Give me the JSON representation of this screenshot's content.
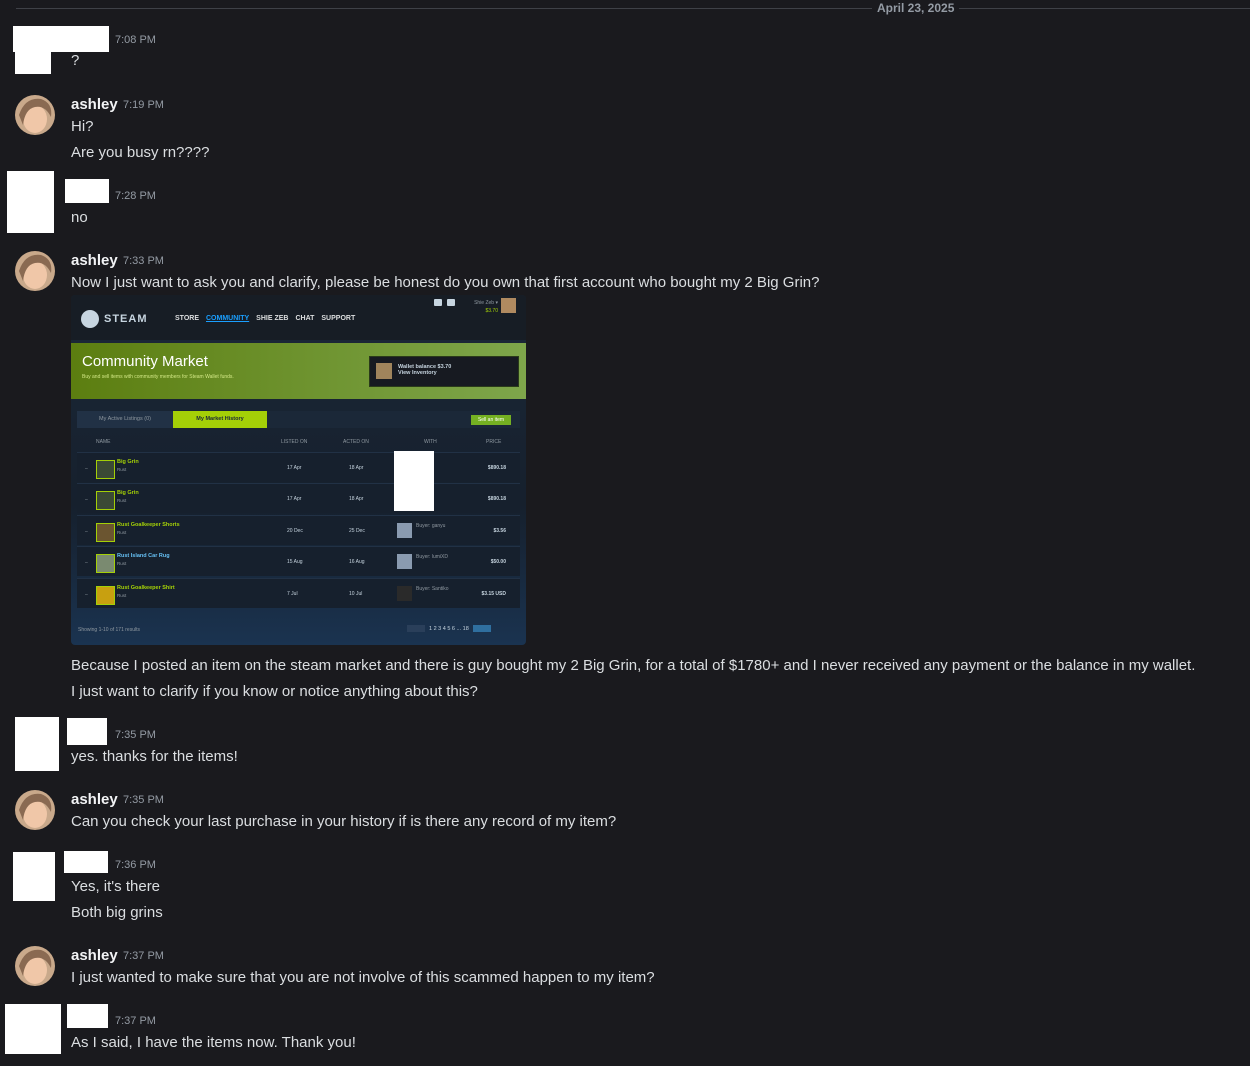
{
  "date_divider": "April 23, 2025",
  "messages": {
    "m1": {
      "time": "7:08 PM",
      "lines": [
        "?"
      ]
    },
    "m2": {
      "author": "ashley",
      "time": "7:19 PM",
      "lines": [
        "Hi?",
        "Are you busy rn????"
      ]
    },
    "m3": {
      "time": "7:28 PM",
      "lines": [
        "no"
      ]
    },
    "m4": {
      "author": "ashley",
      "time": "7:33 PM",
      "lines": [
        "Now I just want to ask you and clarify, please be honest do you own that first account who bought my 2 Big Grin?",
        "Because I posted an item on the steam market and there is guy bought my 2 Big Grin, for a total of $1780+ and I never received any payment or the balance in my wallet.",
        "I just want to clarify if you know or notice anything about this?"
      ]
    },
    "m5": {
      "time": "7:35 PM",
      "lines": [
        "yes. thanks for the items!"
      ]
    },
    "m6": {
      "author": "ashley",
      "time": "7:35 PM",
      "lines": [
        "Can you check your last purchase in your history if is there any record of my item?"
      ]
    },
    "m7": {
      "time": "7:36 PM",
      "lines": [
        "Yes, it's there",
        "Both big grins"
      ]
    },
    "m8": {
      "author": "ashley",
      "time": "7:37 PM",
      "lines": [
        "I just wanted to make sure that you are not involve of this scammed happen to my item?"
      ]
    },
    "m9": {
      "time": "7:37 PM",
      "lines": [
        "As I said, I have the items now. Thank you!"
      ]
    }
  },
  "steam": {
    "logo": "STEAM",
    "nav": [
      "STORE",
      "COMMUNITY",
      "SHIE ZEB",
      "CHAT",
      "SUPPORT"
    ],
    "user_name": "Shie Zeb ▾",
    "user_balance": "$3.70",
    "market_title": "Community Market",
    "market_subtitle": "Buy and sell items with community members for Steam Wallet funds.",
    "wallet_line1": "Wallet balance $3.70",
    "wallet_line2": "View Inventory",
    "tab_active_listings": "My Active Listings (0)",
    "tab_history": "My Market History",
    "sell_button": "Sell an item",
    "columns": [
      "NAME",
      "LISTED ON",
      "ACTED ON",
      "WITH",
      "PRICE"
    ],
    "rows": [
      {
        "name": "Big Grin",
        "game": "Rust",
        "listed": "17 Apr",
        "acted": "18 Apr",
        "buyer": "",
        "price": "$890.18"
      },
      {
        "name": "Big Grin",
        "game": "Rust",
        "listed": "17 Apr",
        "acted": "18 Apr",
        "buyer": "",
        "price": "$890.18"
      },
      {
        "name": "Rust Goalkeeper Shorts",
        "game": "Rust",
        "listed": "20 Dec",
        "acted": "25 Dec",
        "buyer": "Buyer: ganyu",
        "price": "$3.56"
      },
      {
        "name": "Rust Island Car Rug",
        "game": "Rust",
        "listed": "15 Aug",
        "acted": "16 Aug",
        "buyer": "Buyer: lumiXD",
        "price": "$50.00"
      },
      {
        "name": "Rust Goalkeeper Shirt",
        "game": "Rust",
        "listed": "7 Jul",
        "acted": "10 Jul",
        "buyer": "Buyer: Santiko",
        "price": "$3.15 USD"
      }
    ],
    "showing": "Showing 1-10 of 171 results",
    "pages": "1 2 3 4 5 6 ... 18"
  }
}
